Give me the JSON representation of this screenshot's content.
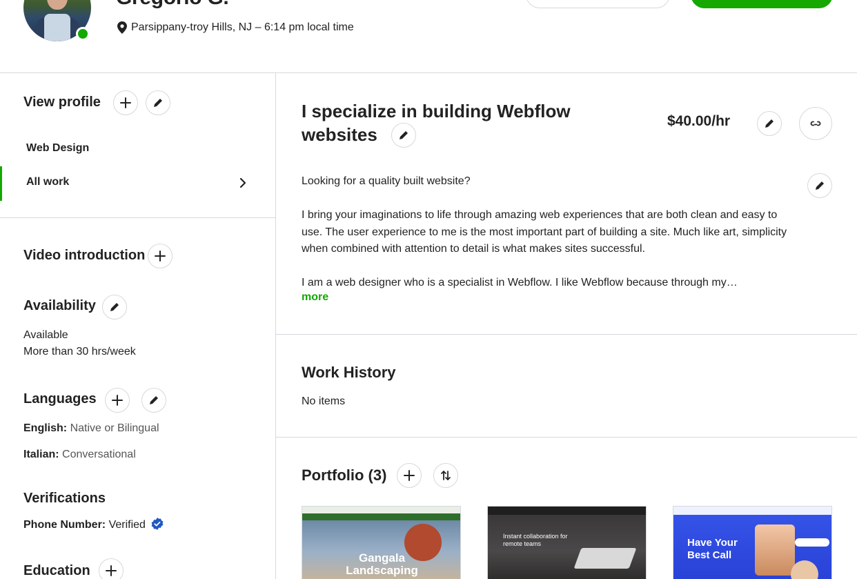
{
  "header": {
    "name": "Gregorio G.",
    "location": "Parsippany-troy Hills, NJ – 6:14 pm local time",
    "online_color": "#14a800"
  },
  "sidebar": {
    "view_profile": "View profile",
    "categories": [
      "Web Design",
      "All work"
    ],
    "video_intro": "Video introduction",
    "availability": {
      "title": "Availability",
      "status": "Available",
      "hours": "More than 30 hrs/week"
    },
    "languages": {
      "title": "Languages",
      "items": [
        {
          "language": "English:",
          "level": "Native or Bilingual"
        },
        {
          "language": "Italian:",
          "level": "Conversational"
        }
      ]
    },
    "verifications": {
      "title": "Verifications",
      "label": "Phone Number:",
      "value": "Verified"
    },
    "education": "Education"
  },
  "main": {
    "headline": "I specialize in building Webflow websites",
    "rate": "$40.00/hr",
    "description": [
      "Looking for a quality built website?",
      "I bring your imaginations to life through amazing web experiences that are both clean and easy to use. The user experience to me is the most important part of building a site. Much like art, simplicity when combined with attention to detail is what makes sites successful.",
      "I am a web designer who is a specialist in Webflow. I like Webflow because through my…"
    ],
    "more": "more",
    "work_history": {
      "title": "Work History",
      "empty": "No items"
    },
    "portfolio": {
      "title": "Portfolio (3)",
      "items": [
        {
          "caption_line1": "Gangala",
          "caption_line2": "Landscaping"
        },
        {
          "caption_line1": "Instant collaboration for",
          "caption_line2": "remote teams"
        },
        {
          "caption_line1": "Have Your",
          "caption_line2": "Best Call"
        }
      ]
    }
  },
  "colors": {
    "accent": "#14a800",
    "border": "#d5d8dc",
    "verified": "#1f57c3"
  }
}
